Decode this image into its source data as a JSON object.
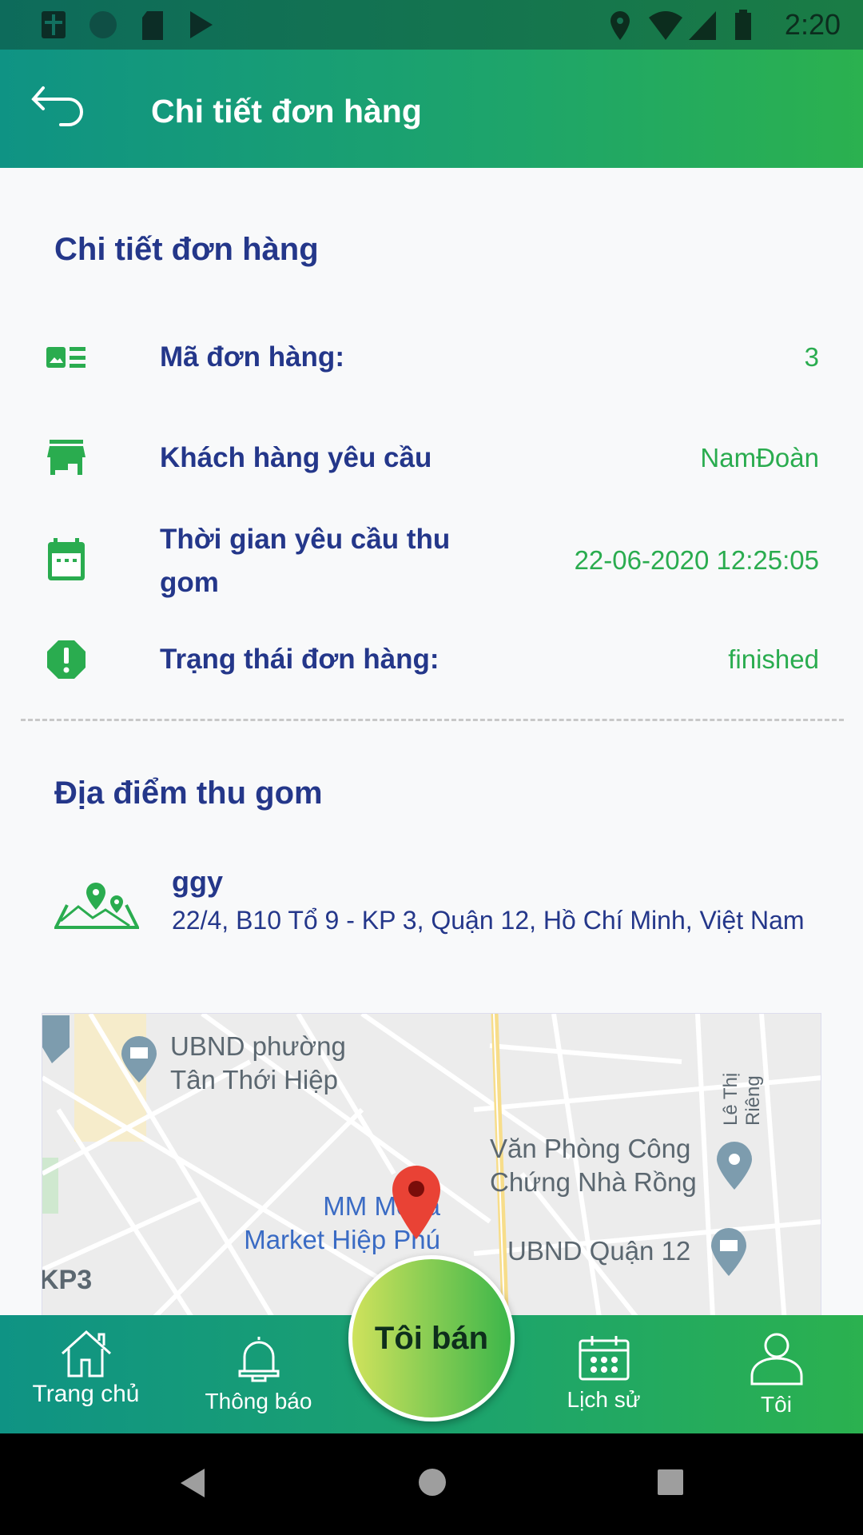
{
  "status_bar": {
    "time": "2:20"
  },
  "app_bar": {
    "title": "Chi tiết đơn hàng"
  },
  "details": {
    "title": "Chi tiết đơn hàng",
    "rows": [
      {
        "label": "Mã đơn hàng:",
        "value": "3",
        "icon": "order-id-icon"
      },
      {
        "label": "Khách hàng yêu cầu",
        "value": "NamĐoàn",
        "icon": "store-icon"
      },
      {
        "label": "Thời gian yêu cầu thu gom",
        "value": "22-06-2020 12:25:05",
        "icon": "calendar-icon"
      },
      {
        "label": "Trạng thái đơn hàng:",
        "value": "finished",
        "icon": "alert-octagon-icon"
      }
    ]
  },
  "location": {
    "title": "Địa điểm thu gom",
    "name": "ggy",
    "address": "22/4, B10 Tổ 9 - KP 3, Quận 12, Hồ Chí Minh, Việt Nam"
  },
  "map": {
    "labels": {
      "ubnd_phuong_1": "UBND phường",
      "ubnd_phuong_2": "Tân Thới Hiệp",
      "vp_1": "Văn Phòng Công",
      "vp_2": "Chứng Nhà Rồng",
      "mm_1": "MM Mega",
      "mm_2": "Market Hiệp Phú",
      "ubnd_q12": "UBND Quận 12",
      "street": "Lê Thị Riêng",
      "kp3": "KP3"
    }
  },
  "bottom_nav": {
    "items": [
      {
        "label": "Trang chủ"
      },
      {
        "label": "Thông báo"
      },
      {
        "label": "Lịch sử"
      },
      {
        "label": "Tôi"
      }
    ],
    "center_label": "Tôi bán"
  },
  "colors": {
    "primary_navy": "#24378a",
    "accent_green": "#2aac4f",
    "gradient_start": "#0f9384",
    "gradient_end": "#2bb14f"
  }
}
